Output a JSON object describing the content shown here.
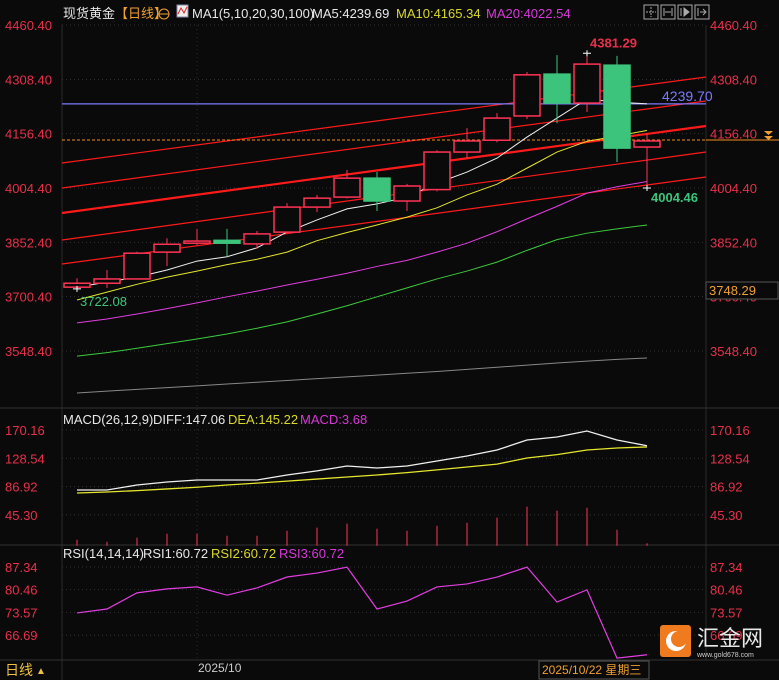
{
  "header": {
    "symbol": "现货黄金",
    "period_tag": "【日线】",
    "target_icon": "crosshair-circle-icon",
    "ma_icon": "indicator-chart-icon",
    "ma_params": "MA1(5,10,20,30,100)",
    "ma5": "MA5:4239.69",
    "ma10": "MA10:4165.34",
    "ma20": "MA20:4022.54",
    "toolbar_icons": [
      "crosshair-icon",
      "fit-range-icon",
      "play-forward-icon",
      "jump-end-icon"
    ]
  },
  "colors": {
    "background": "#0a0a0a",
    "up": "#ff3355",
    "down": "#3cc47c",
    "axis_text": "#e8304a",
    "ma5": "#f0f0f0",
    "ma10": "#e6e62e",
    "ma20": "#e23ee2",
    "ma30": "#3ccc3c",
    "ma100": "#888888",
    "channel": "#ff1a1a",
    "price_line": "#7b7bff",
    "current_line": "#f08c1e"
  },
  "chart_data": [
    {
      "type": "candlestick",
      "title": "现货黄金 日线",
      "ylim": [
        3490,
        4460.4
      ],
      "yticks": [
        "4460.40",
        "4308.40",
        "4156.40",
        "4004.40",
        "3852.40",
        "3700.40",
        "3548.40"
      ],
      "ytick_values": [
        4460.4,
        4308.4,
        4156.4,
        4004.4,
        3852.4,
        3700.4,
        3548.4
      ],
      "xlabel_tick": "2025/10",
      "x_tick_index": 4,
      "candles": [
        [
          3727,
          3752,
          3722.08,
          3738
        ],
        [
          3738,
          3775,
          3725,
          3750
        ],
        [
          3750,
          3826,
          3748,
          3822
        ],
        [
          3825,
          3864,
          3786,
          3847
        ],
        [
          3850,
          3890,
          3845,
          3856
        ],
        [
          3858,
          3890,
          3812,
          3850
        ],
        [
          3848,
          3884,
          3834,
          3876
        ],
        [
          3881,
          3962,
          3878,
          3951
        ],
        [
          3951,
          3985,
          3937,
          3976
        ],
        [
          3979,
          4055,
          3975,
          4032
        ],
        [
          4032,
          4049,
          3940,
          3968
        ],
        [
          3968,
          4016,
          3940,
          4010
        ],
        [
          4000,
          4110,
          3995,
          4105
        ],
        [
          4105,
          4172,
          4088,
          4136
        ],
        [
          4138,
          4214,
          4132,
          4200
        ],
        [
          4206,
          4329,
          4197,
          4321
        ],
        [
          4323,
          4376,
          4186,
          4242
        ],
        [
          4242,
          4381.29,
          4217,
          4351
        ],
        [
          4348,
          4374,
          4077,
          4116
        ],
        [
          4119,
          4158,
          4004.46,
          4136
        ]
      ],
      "ma_series": [
        {
          "name": "MA5",
          "values": [
            3727,
            3741,
            3755,
            3775,
            3800,
            3812,
            3837,
            3881,
            3915,
            3946,
            3960,
            3979,
            4018,
            4049,
            4088,
            4147,
            4200,
            4253,
            4245,
            4239.69
          ]
        },
        {
          "name": "MA10",
          "values": [
            3691,
            3713,
            3735,
            3755,
            3772,
            3790,
            3805,
            3825,
            3857,
            3880,
            3901,
            3923,
            3949,
            3985,
            4015,
            4060,
            4105,
            4135,
            4150,
            4165.34
          ]
        },
        {
          "name": "MA20",
          "values": [
            3627,
            3638,
            3652,
            3667,
            3683,
            3700,
            3716,
            3733,
            3749,
            3766,
            3785,
            3802,
            3825,
            3850,
            3882,
            3918,
            3953,
            3990,
            4008,
            4022.54
          ]
        },
        {
          "name": "MA30",
          "values": [
            3534,
            3544,
            3556,
            3569,
            3582,
            3596,
            3612,
            3630,
            3652,
            3675,
            3700,
            3725,
            3750,
            3772,
            3797,
            3830,
            3860,
            3878,
            3890,
            3901
          ]
        },
        {
          "name": "MA100",
          "values": [
            3431,
            3436,
            3441,
            3446,
            3451,
            3456,
            3461,
            3466,
            3471,
            3476,
            3481,
            3486,
            3491,
            3497,
            3503,
            3509,
            3515,
            3520,
            3525,
            3529
          ]
        }
      ],
      "channel_lines": [
        {
          "start": 4074.4,
          "end": 4314.9,
          "bold": false
        },
        {
          "start": 4004.4,
          "end": 4247.8,
          "bold": false
        },
        {
          "start": 3934.5,
          "end": 4177.9,
          "bold": true
        },
        {
          "start": 3858.9,
          "end": 4105.1,
          "bold": false
        },
        {
          "start": 3791.8,
          "end": 4035.2,
          "bold": false
        }
      ],
      "horizontal_line": {
        "value": 4239.7,
        "label": "4239.70"
      },
      "current_price_line": {
        "value": 4138.7
      },
      "annotations": {
        "high": "4381.29",
        "low": "4004.46",
        "first_low": "3722.08",
        "cursor_price": "3748.29"
      }
    },
    {
      "type": "line",
      "title": "MACD(26,12,9)",
      "legend": {
        "params": "MACD(26,12,9)",
        "diff": "DIFF:147.06",
        "dea": "DEA:145.22",
        "macd": "MACD:3.68"
      },
      "yticks": [
        "170.16",
        "128.54",
        "86.92",
        "45.30"
      ],
      "ytick_values": [
        170.16,
        128.54,
        86.92,
        45.3
      ],
      "series": [
        {
          "name": "DIFF",
          "values": [
            81.9,
            81.9,
            89.3,
            93.7,
            96.6,
            96.6,
            96.6,
            104,
            110,
            117.2,
            114.3,
            117.2,
            124.6,
            131.9,
            140.7,
            155.5,
            159.9,
            168.7,
            155.5,
            147.06
          ]
        },
        {
          "name": "DEA",
          "values": [
            77.5,
            79,
            81,
            83.5,
            86,
            89.3,
            92,
            95,
            98,
            101,
            104,
            107.5,
            111.5,
            115.7,
            120,
            129,
            134,
            140.7,
            143.7,
            145.22
          ]
        },
        {
          "name": "MACD",
          "values": [
            8.8,
            5.9,
            11.8,
            17.6,
            17.6,
            14.7,
            14.7,
            22,
            26.5,
            32.4,
            25,
            22,
            29.4,
            33.8,
            41.2,
            57.4,
            51.5,
            55.9,
            23.5,
            3.68
          ]
        }
      ]
    },
    {
      "type": "line",
      "title": "RSI(14,14,14)",
      "legend": {
        "params": "RSI(14,14,14)",
        "rsi1": "RSI1:60.72",
        "rsi2": "RSI2:60.72",
        "rsi3": "RSI3:60.72"
      },
      "yticks": [
        "87.34",
        "80.46",
        "73.57",
        "66.69"
      ],
      "ytick_values": [
        87.34,
        80.46,
        73.57,
        66.69
      ],
      "series": [
        {
          "name": "RSI",
          "values": [
            73.4,
            74.6,
            79.5,
            80.7,
            81.3,
            78.8,
            81.0,
            84.3,
            85.5,
            87.3,
            74.6,
            77.0,
            81.3,
            82.2,
            84.3,
            87.3,
            76.7,
            80.4,
            59.7,
            60.72
          ]
        }
      ]
    }
  ],
  "footer": {
    "period": "日线",
    "period_arrow": "▲",
    "month_label": "2025/10",
    "cursor_date": "2025/10/22 星期三"
  },
  "watermark": {
    "brand": "汇金网",
    "url": "www.gold678.com"
  }
}
